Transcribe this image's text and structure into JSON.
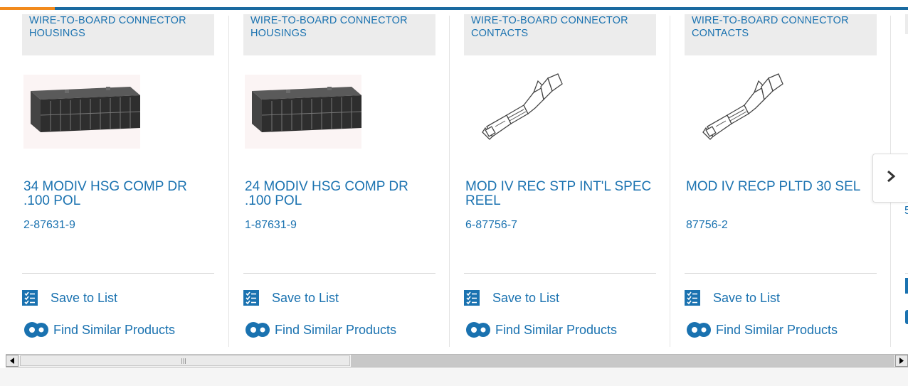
{
  "colors": {
    "accent_blue": "#1a72b0",
    "top_bar_orange": "#f28a1c",
    "category_bg": "#ececec"
  },
  "products": [
    {
      "category": "WIRE-TO-BOARD CONNECTOR HOUSINGS",
      "image_icon": "connector-housing-image",
      "title": "34 MODIV HSG COMP DR .100 POL",
      "part_number": "2-87631-9",
      "save_label": "Save to List",
      "similar_label": "Find Similar Products"
    },
    {
      "category": "WIRE-TO-BOARD CONNECTOR HOUSINGS",
      "image_icon": "connector-housing-image",
      "title": "24 MODIV HSG COMP DR .100 POL",
      "part_number": "1-87631-9",
      "save_label": "Save to List",
      "similar_label": "Find Similar Products"
    },
    {
      "category": "WIRE-TO-BOARD CONNECTOR CONTACTS",
      "image_icon": "crimp-contact-image",
      "title": "MOD IV REC STP INT'L SPEC REEL",
      "part_number": "6-87756-7",
      "save_label": "Save to List",
      "similar_label": "Find Similar Products"
    },
    {
      "category": "WIRE-TO-BOARD CONNECTOR CONTACTS",
      "image_icon": "crimp-contact-image",
      "title": "MOD IV RECP PLTD 30 SEL",
      "part_number": "87756-2",
      "save_label": "Save to List",
      "similar_label": "Find Similar Products"
    }
  ],
  "partial_card": {
    "part_number_fragment": "5"
  },
  "carousel": {
    "next_icon": "chevron-right-icon"
  },
  "scrollbar": {
    "left_icon": "scroll-left-arrow-icon",
    "right_icon": "scroll-right-arrow-icon",
    "position_fraction": 0.0,
    "visible_fraction": 0.37
  }
}
